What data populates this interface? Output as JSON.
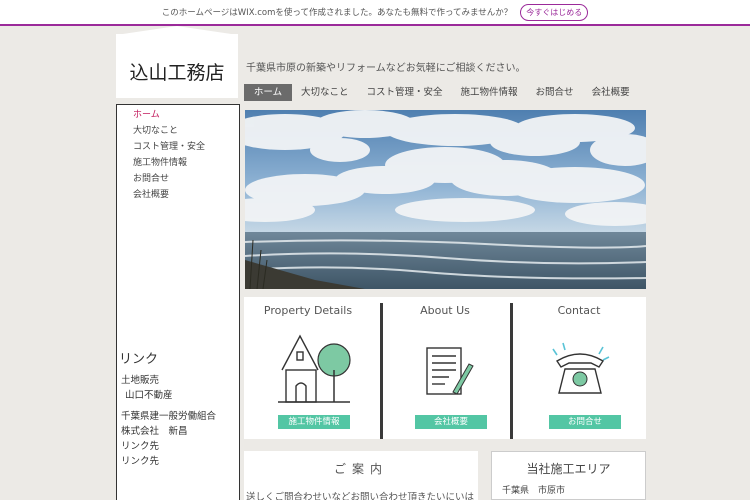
{
  "wix_banner": {
    "message": "このホームページはWIX.comを使って作成されました。あなたも無料で作ってみませんか？",
    "button_label": "今すぐはじめる"
  },
  "site": {
    "logo_text": "込山工務店",
    "tagline": "千葉県市原の新築やリフォームなどお気軽にご相談ください。"
  },
  "topnav": [
    {
      "label": "ホーム",
      "active": true
    },
    {
      "label": "大切なこと"
    },
    {
      "label": "コスト管理・安全"
    },
    {
      "label": "施工物件情報"
    },
    {
      "label": "お問合せ"
    },
    {
      "label": "会社概要"
    }
  ],
  "sidebar": {
    "menu": [
      {
        "label": "ホーム",
        "active": true
      },
      {
        "label": "大切なこと"
      },
      {
        "label": "コスト管理・安全"
      },
      {
        "label": "施工物件情報"
      },
      {
        "label": "お問合せ"
      },
      {
        "label": "会社概要"
      }
    ],
    "links_title": "リンク",
    "links": [
      {
        "label": "土地販売"
      },
      {
        "label": "山口不動産"
      },
      {
        "label": "千葉県建一般労働組合"
      },
      {
        "label": "株式会社　新昌"
      },
      {
        "label": "リンク先"
      },
      {
        "label": "リンク先"
      }
    ]
  },
  "panels": [
    {
      "title": "Property Details",
      "button": "施工物件情報"
    },
    {
      "title": "About Us",
      "button": "会社概要"
    },
    {
      "title": "Contact",
      "button": "お問合せ"
    }
  ],
  "info": {
    "title": "ご案内",
    "text": "送しくご問合わせいなどお問い合わせ頂きたいにいは"
  },
  "area": {
    "title": "当社施工エリア",
    "items": [
      "千葉県　市原市"
    ]
  }
}
